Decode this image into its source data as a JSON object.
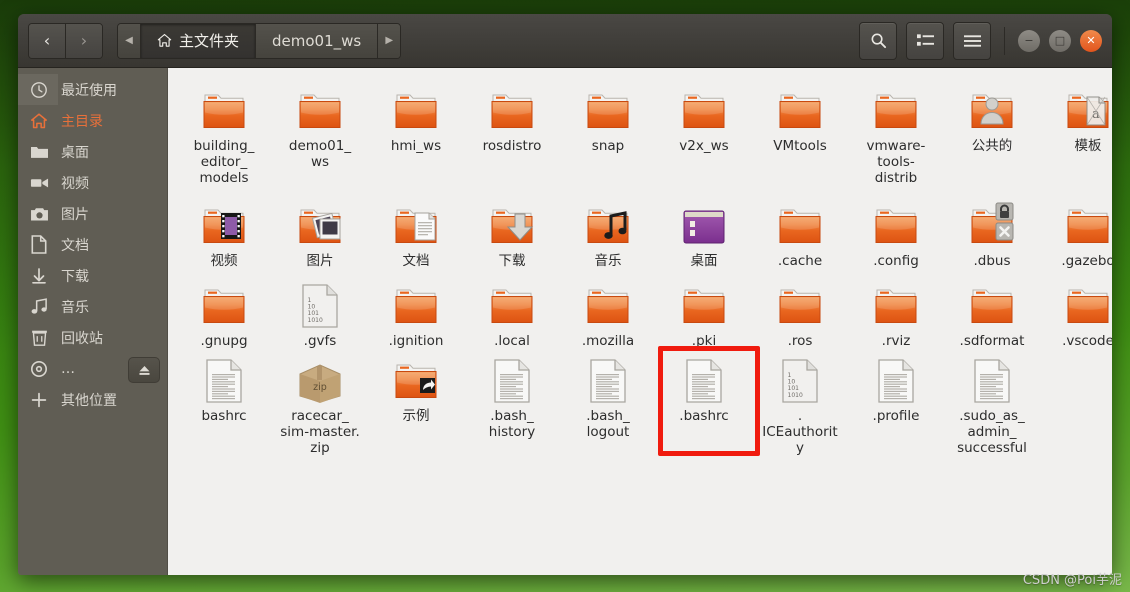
{
  "window": {
    "title": "主文件夹",
    "colors": {
      "header_bg": "#413f3b",
      "sidebar_bg": "#605d54",
      "file_area_bg": "#f1f0ee",
      "accent": "#e8703a",
      "close_button": "#e2541c",
      "annotation": "#f01b0e",
      "folder": "#e8601c"
    }
  },
  "toolbar": {
    "back_label": "‹",
    "forward_label": "›",
    "left_arrow": "◀",
    "right_arrow": "▶",
    "search_icon": "search-icon",
    "view_icon": "list-view-icon",
    "menu_icon": "hamburger-menu-icon",
    "minimize_label": "−",
    "maximize_label": "□",
    "close_label": "✕"
  },
  "breadcrumb": [
    {
      "label": "主文件夹",
      "icon": "home-icon",
      "active": true
    },
    {
      "label": "demo01_ws",
      "icon": "",
      "active": false
    }
  ],
  "sidebar": {
    "items": [
      {
        "label": "最近使用",
        "icon": "clock-icon",
        "selected": false,
        "eject": false
      },
      {
        "label": "主目录",
        "icon": "home-icon",
        "selected": true,
        "eject": false
      },
      {
        "label": "桌面",
        "icon": "folder-icon",
        "selected": false,
        "eject": false
      },
      {
        "label": "视频",
        "icon": "video-camera-icon",
        "selected": false,
        "eject": false
      },
      {
        "label": "图片",
        "icon": "camera-icon",
        "selected": false,
        "eject": false
      },
      {
        "label": "文档",
        "icon": "document-icon",
        "selected": false,
        "eject": false
      },
      {
        "label": "下载",
        "icon": "download-icon",
        "selected": false,
        "eject": false
      },
      {
        "label": "音乐",
        "icon": "music-note-icon",
        "selected": false,
        "eject": false
      },
      {
        "label": "回收站",
        "icon": "trash-icon",
        "selected": false,
        "eject": false
      },
      {
        "label": "…",
        "icon": "disc-icon",
        "selected": false,
        "eject": true
      },
      {
        "label": "其他位置",
        "icon": "plus-icon",
        "selected": false,
        "eject": false
      }
    ]
  },
  "files": [
    {
      "name": "building_\neditor_\nmodels",
      "type": "folder",
      "highlighted": false
    },
    {
      "name": "demo01_\nws",
      "type": "folder",
      "highlighted": false
    },
    {
      "name": "hmi_ws",
      "type": "folder",
      "highlighted": false
    },
    {
      "name": "rosdistro",
      "type": "folder",
      "highlighted": false
    },
    {
      "name": "snap",
      "type": "folder",
      "highlighted": false
    },
    {
      "name": "v2x_ws",
      "type": "folder",
      "highlighted": false
    },
    {
      "name": "VMtools",
      "type": "folder",
      "highlighted": false
    },
    {
      "name": "vmware-\ntools-\ndistrib",
      "type": "folder",
      "highlighted": false
    },
    {
      "name": "公共的",
      "type": "folder-public",
      "highlighted": false
    },
    {
      "name": "模板",
      "type": "folder-templates",
      "highlighted": false
    },
    {
      "name": "视频",
      "type": "folder-videos",
      "highlighted": false
    },
    {
      "name": "图片",
      "type": "folder-pictures",
      "highlighted": false
    },
    {
      "name": "文档",
      "type": "folder-documents",
      "highlighted": false
    },
    {
      "name": "下载",
      "type": "folder-downloads",
      "highlighted": false
    },
    {
      "name": "音乐",
      "type": "folder-music",
      "highlighted": false
    },
    {
      "name": "桌面",
      "type": "folder-desktop",
      "highlighted": false
    },
    {
      "name": ".cache",
      "type": "folder",
      "highlighted": false
    },
    {
      "name": ".config",
      "type": "folder",
      "highlighted": false
    },
    {
      "name": ".dbus",
      "type": "folder-locked",
      "highlighted": false
    },
    {
      "name": ".gazebo",
      "type": "folder",
      "highlighted": false
    },
    {
      "name": ".gnupg",
      "type": "folder",
      "highlighted": false
    },
    {
      "name": ".gvfs",
      "type": "binary-file",
      "highlighted": false
    },
    {
      "name": ".ignition",
      "type": "folder",
      "highlighted": false
    },
    {
      "name": ".local",
      "type": "folder",
      "highlighted": false
    },
    {
      "name": ".mozilla",
      "type": "folder",
      "highlighted": false
    },
    {
      "name": ".pki",
      "type": "folder",
      "highlighted": false
    },
    {
      "name": ".ros",
      "type": "folder",
      "highlighted": false
    },
    {
      "name": ".rviz",
      "type": "folder",
      "highlighted": false
    },
    {
      "name": ".sdformat",
      "type": "folder",
      "highlighted": false
    },
    {
      "name": ".vscode",
      "type": "folder",
      "highlighted": false
    },
    {
      "name": "bashrc",
      "type": "text-file",
      "highlighted": false
    },
    {
      "name": "racecar_\nsim-master.\nzip",
      "type": "archive-file",
      "highlighted": false
    },
    {
      "name": "示例",
      "type": "folder-link",
      "highlighted": false
    },
    {
      "name": ".bash_\nhistory",
      "type": "text-file",
      "highlighted": false
    },
    {
      "name": ".bash_\nlogout",
      "type": "text-file",
      "highlighted": false
    },
    {
      "name": ".bashrc",
      "type": "text-file",
      "highlighted": true
    },
    {
      "name": ".\nICEauthorit\ny",
      "type": "binary-file",
      "highlighted": false
    },
    {
      "name": ".profile",
      "type": "text-file",
      "highlighted": false
    },
    {
      "name": ".sudo_as_\nadmin_\nsuccessful",
      "type": "text-file",
      "highlighted": false
    }
  ],
  "binary_file_lines": [
    "1",
    "10",
    "101",
    "1010"
  ],
  "archive_label": "zip",
  "watermark": "CSDN @Poi芋泥"
}
